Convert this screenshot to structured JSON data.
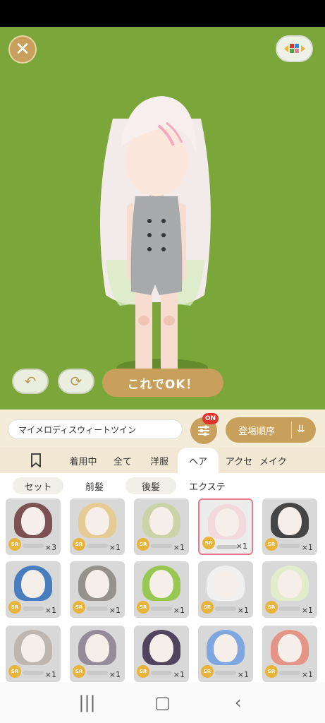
{
  "stage": {
    "ok_label": "これでOK！",
    "bg_color": "#7aa63a"
  },
  "toolbar": {
    "name": "マイメロディスウィートツイン",
    "filter_badge": "ON",
    "sort_label": "登場順序"
  },
  "tabs": [
    {
      "label": "着用中"
    },
    {
      "label": "全て"
    },
    {
      "label": "洋服"
    },
    {
      "label": "ヘア",
      "active": true
    },
    {
      "label": "アクセ"
    },
    {
      "label": "メイク"
    }
  ],
  "subtabs": [
    {
      "label": "セット"
    },
    {
      "label": "前髪"
    },
    {
      "label": "後髪"
    },
    {
      "label": "エクステ"
    }
  ],
  "items": [
    {
      "rarity": "SR",
      "count": "×3",
      "hair": "#6b3a3a"
    },
    {
      "rarity": "SR",
      "count": "×1",
      "hair": "#e9c98a"
    },
    {
      "rarity": "SR",
      "count": "×1",
      "hair": "#c9d3a0"
    },
    {
      "rarity": "SR",
      "count": "×1",
      "hair": "#f3d6dc",
      "selected": true
    },
    {
      "rarity": "SR",
      "count": "×1",
      "hair": "#2b2b2b"
    },
    {
      "rarity": "SR",
      "count": "×1",
      "hair": "#2f6fb8"
    },
    {
      "rarity": "SR",
      "count": "×1",
      "hair": "#8a8580"
    },
    {
      "rarity": "SR",
      "count": "×1",
      "hair": "#8cc63a"
    },
    {
      "rarity": "SR",
      "count": "×1",
      "hair": "#f5f5f5"
    },
    {
      "rarity": "SR",
      "count": "×1",
      "hair": "#e5f0c8"
    },
    {
      "rarity": "SR",
      "count": "×1",
      "hair": "#b8b0aa"
    },
    {
      "rarity": "SR",
      "count": "×1",
      "hair": "#8a7f8f"
    },
    {
      "rarity": "SR",
      "count": "×1",
      "hair": "#3a2a4a"
    },
    {
      "rarity": "SR",
      "count": "×1",
      "hair": "#6f9de0"
    },
    {
      "rarity": "SR",
      "count": "×1",
      "hair": "#e88a7a"
    }
  ],
  "colors": {
    "accent": "#c8a05c",
    "badge": "#e2342a",
    "selected_border": "#e77a8c"
  }
}
